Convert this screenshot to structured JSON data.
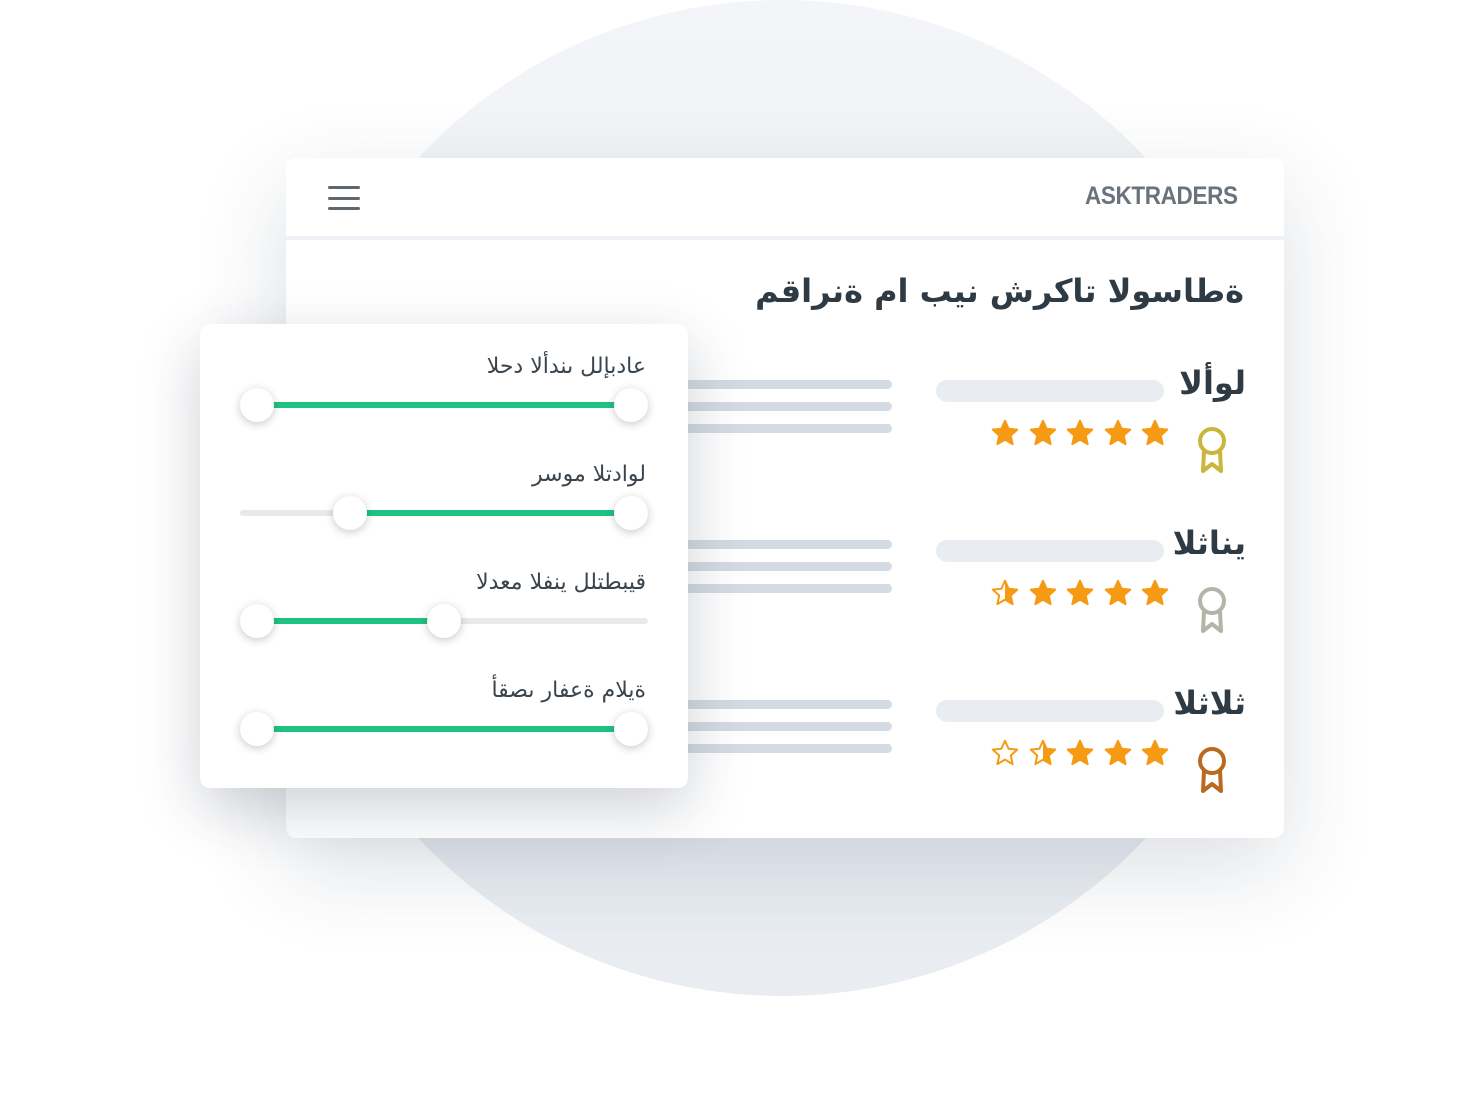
{
  "header": {
    "logo": "ASKTRADERS",
    "menu_icon": "hamburger-menu-icon"
  },
  "main": {
    "title": "ةطاسولا تاكرش نيب ام ةنراقم",
    "ranks": [
      {
        "label": "لوألا",
        "rating": 5,
        "medal": "gold-medal-icon",
        "medal_color": "#c9b63a"
      },
      {
        "label": "يناثلا",
        "rating": 4.5,
        "medal": "silver-medal-icon",
        "medal_color": "#b4b4a8"
      },
      {
        "label": "ثلاثلا",
        "rating": 3.5,
        "medal": "bronze-medal-icon",
        "medal_color": "#b96a1c"
      }
    ]
  },
  "filters": [
    {
      "label": "عادبإلل ىندألا دحلا",
      "range": [
        0,
        1
      ]
    },
    {
      "label": "لوادتلا موسر",
      "range": [
        0.27,
        1
      ]
    },
    {
      "label": "قيبطتلل ينفلا معدلا",
      "range": [
        0,
        0.5
      ]
    },
    {
      "label": "ةيلام ةعفار ىصقأ",
      "range": [
        0,
        0.96
      ]
    }
  ],
  "colors": {
    "accent": "#1fc282",
    "star": "#f59a12",
    "title_text": "#2e3a44"
  }
}
